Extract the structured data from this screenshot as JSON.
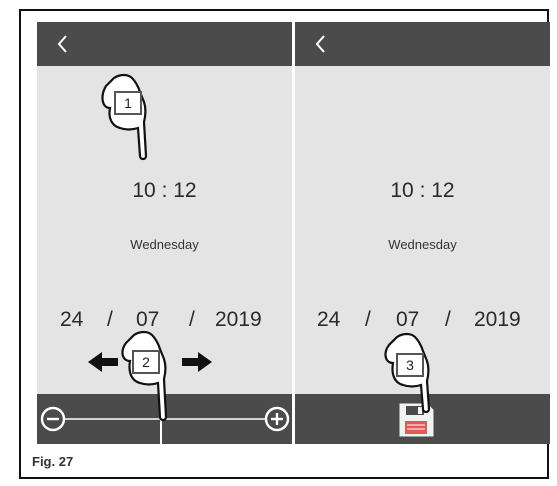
{
  "figure_caption": "Fig. 27",
  "steps": [
    "1",
    "2",
    "3"
  ],
  "left_screen": {
    "back_icon": "chevron-left-icon",
    "time": "10 : 12",
    "weekday": "Wednesday",
    "date": {
      "day": "24",
      "month": "07",
      "year": "2019",
      "separator": "/"
    },
    "slider": {
      "minus_icon": "minus-circle-icon",
      "plus_icon": "plus-circle-icon",
      "position": 0.5
    }
  },
  "right_screen": {
    "back_icon": "chevron-left-icon",
    "time": "10 : 12",
    "weekday": "Wednesday",
    "date": {
      "day": "24",
      "month": "07",
      "year": "2019",
      "separator": "/"
    },
    "save_icon": "floppy-disk-icon"
  },
  "hint_icons": [
    "pointing-hand-icon",
    "arrow-left-icon",
    "arrow-right-icon"
  ],
  "colors": {
    "bar": "#4b4b4b",
    "screen": "#e4e4e4",
    "text": "#2a2a2a"
  }
}
